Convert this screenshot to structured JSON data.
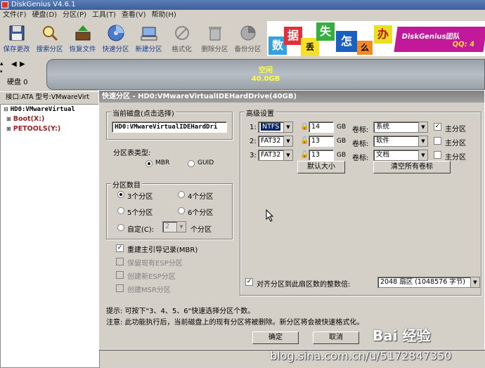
{
  "app": {
    "title": "DiskGenius V4.6.1"
  },
  "menu": [
    "文件(F)",
    "硬盘(D)",
    "分区(P)",
    "工具(T)",
    "查看(V)",
    "帮助(H)"
  ],
  "toolbar": [
    {
      "label": "保存更改",
      "icon": "save-icon"
    },
    {
      "label": "搜索分区",
      "icon": "search-icon"
    },
    {
      "label": "恢复文件",
      "icon": "recover-icon"
    },
    {
      "label": "快速分区",
      "icon": "disk-icon"
    },
    {
      "label": "新建分区",
      "icon": "new-partition-icon"
    },
    {
      "label": "格式化",
      "icon": "format-icon"
    },
    {
      "label": "删除分区",
      "icon": "trash-icon"
    },
    {
      "label": "备份分区",
      "icon": "backup-icon"
    }
  ],
  "banner": {
    "tiles": [
      "数",
      "据",
      "丢",
      "失",
      "怎",
      "么",
      "办"
    ],
    "brand": "DiskGenius团队",
    "qq": "QQ: 4"
  },
  "diskbar": {
    "disk_label": "硬盘 0",
    "free_label": "空闲",
    "free_size": "40.0GB"
  },
  "infobar": {
    "text": "接口:ATA  型号:VMwareVirt"
  },
  "tree": {
    "disk": "HD0:VMwareVirtual",
    "partitions": [
      "Boot(X:)",
      "PETOOLS(Y:)"
    ]
  },
  "dialog": {
    "title": "快速分区 - HD0:VMwareVirtualIDEHardDrive(40GB)",
    "current_disk_label": "当前磁盘(点击选择)",
    "current_disk_value": "HD0:VMwareVirtualIDEHardDri",
    "table_type_label": "分区表类型:",
    "table_types": [
      "MBR",
      "GUID"
    ],
    "part_count_label": "分区数目",
    "part_counts": [
      "3个分区",
      "4个分区",
      "5个分区",
      "6个分区"
    ],
    "custom_label": "自定(C):",
    "custom_value": "2",
    "custom_unit": "个分区",
    "options": [
      {
        "label": "重建主引导记录(MBR)",
        "checked": true,
        "enabled": true
      },
      {
        "label": "保留现有ESP分区",
        "checked": false,
        "enabled": false
      },
      {
        "label": "创建新ESP分区",
        "checked": false,
        "enabled": false
      },
      {
        "label": "创建MSR分区",
        "checked": false,
        "enabled": false
      }
    ],
    "advanced_label": "高级设置",
    "rows": [
      {
        "num": "1:",
        "fs": "NTFS",
        "size": "14",
        "unit": "GB",
        "vol_label": "卷标:",
        "volume": "系统",
        "primary": "主分区",
        "primary_checked": true
      },
      {
        "num": "2:",
        "fs": "FAT32",
        "size": "13",
        "unit": "GB",
        "vol_label": "卷标:",
        "volume": "软件",
        "primary": "主分区",
        "primary_checked": false
      },
      {
        "num": "3:",
        "fs": "FAT32",
        "size": "13",
        "unit": "GB",
        "vol_label": "卷标:",
        "volume": "文档",
        "primary": "主分区",
        "primary_checked": false
      }
    ],
    "default_size_button": "默认大小",
    "clear_labels_button": "清空所有卷标",
    "align_label": "对齐分区到此扇区数的整数倍:",
    "align_value": "2048 扇区 (1048576 字节)",
    "tip1": "提示: 可按下\"3、4、5、6\"快速选择分区个数。",
    "tip2": "注意: 此功能执行后，当前磁盘上的现有分区将被删除。新分区将会被快速格式化。",
    "ok_button": "确定",
    "cancel_button": "取消"
  },
  "watermark": {
    "baidu": "Bai 经验",
    "url": "blog.sina.com.cn/u/5172847350"
  }
}
